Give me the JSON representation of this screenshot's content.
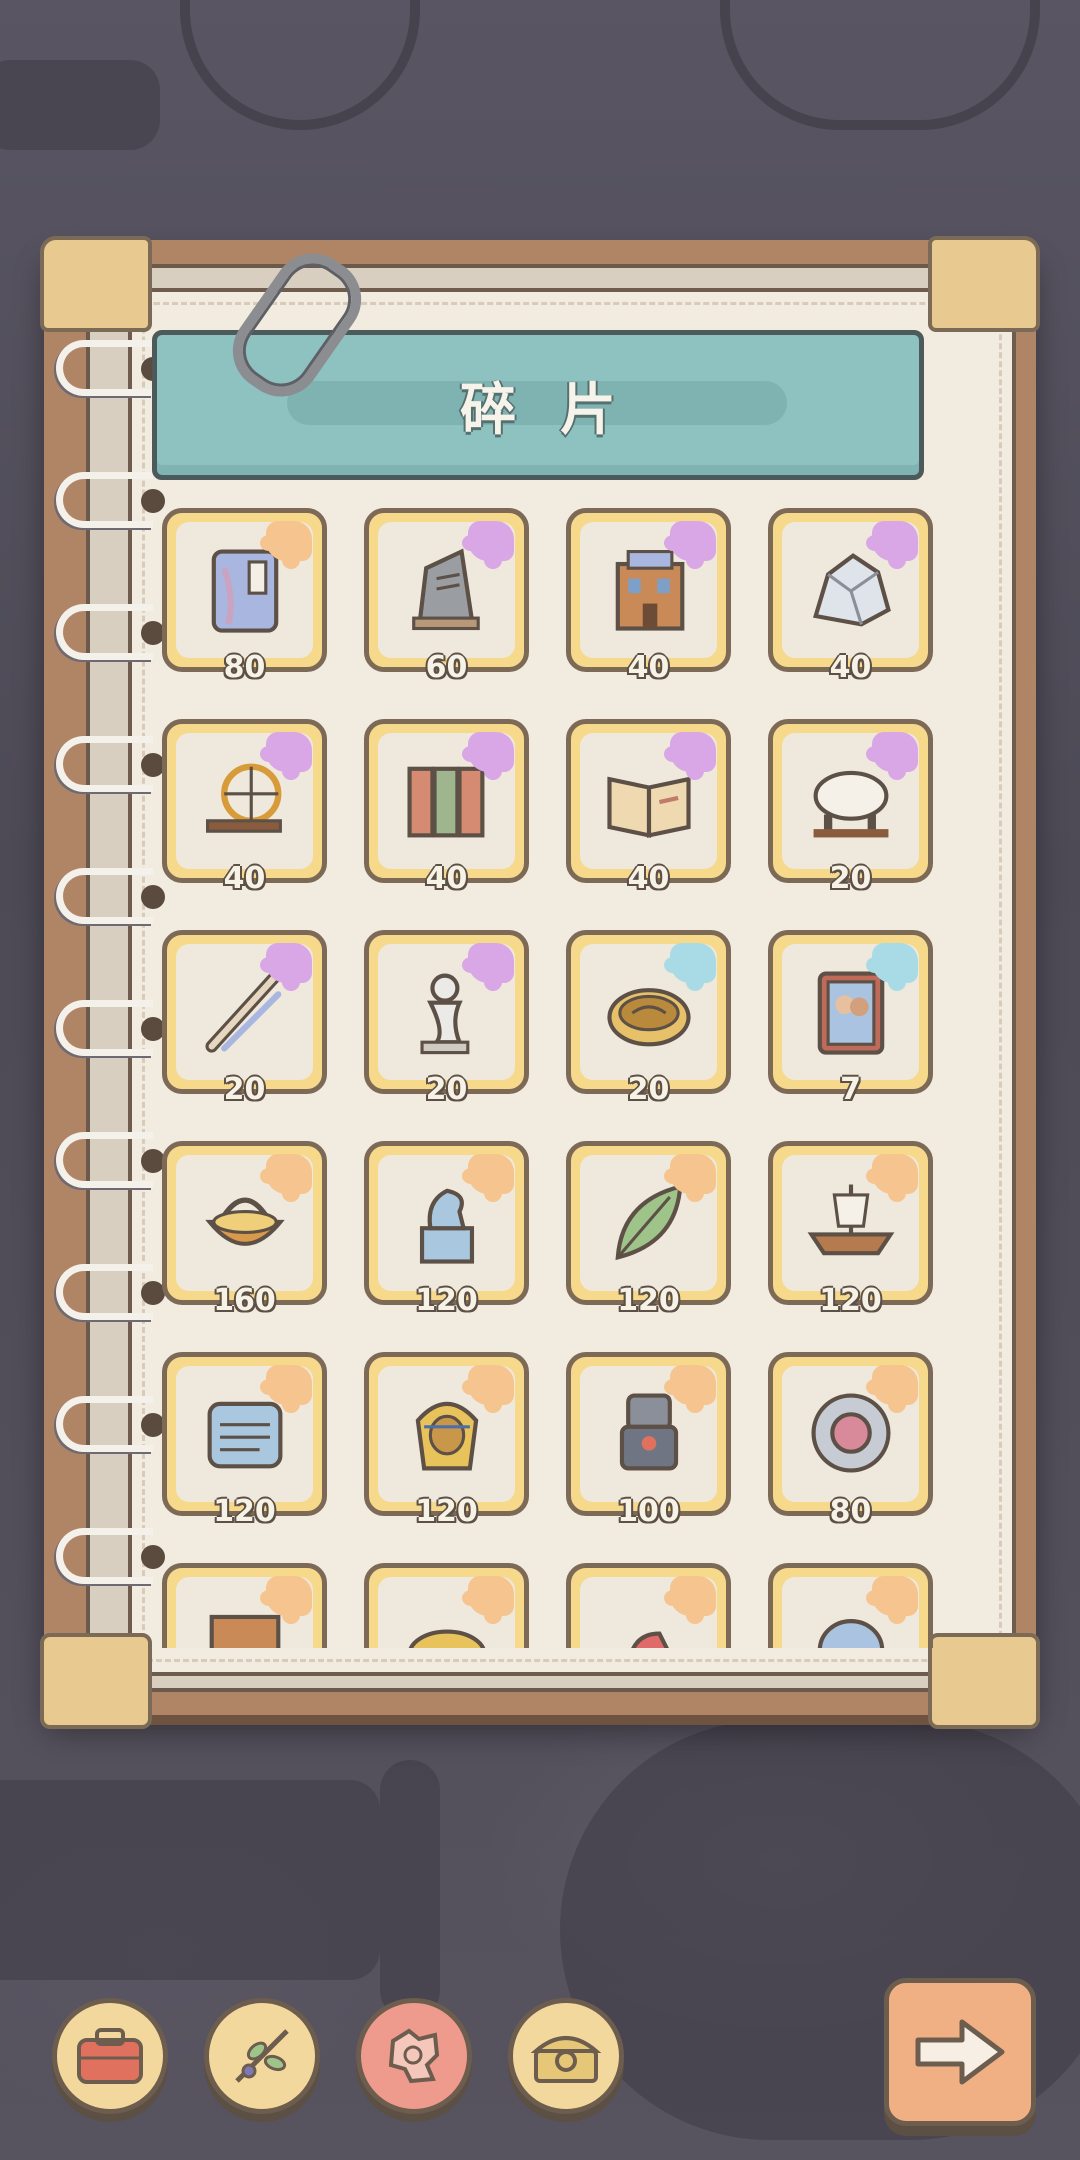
{
  "panel": {
    "title": "碎片"
  },
  "fragments": [
    {
      "name": "book-fragment",
      "count": "80",
      "badge_color": "#f6c48f"
    },
    {
      "name": "stone-tablet-fragment",
      "count": "60",
      "badge_color": "#d9a6e6"
    },
    {
      "name": "building-fragment",
      "count": "40",
      "badge_color": "#d9a6e6"
    },
    {
      "name": "crystal-rock-fragment",
      "count": "40",
      "badge_color": "#d9a6e6"
    },
    {
      "name": "spinning-wheel-fragment",
      "count": "40",
      "badge_color": "#d9a6e6"
    },
    {
      "name": "folding-screen-fragment",
      "count": "40",
      "badge_color": "#d9a6e6"
    },
    {
      "name": "open-book-fragment",
      "count": "40",
      "badge_color": "#d9a6e6"
    },
    {
      "name": "sheep-statue-fragment",
      "count": "20",
      "badge_color": "#d9a6e6"
    },
    {
      "name": "quill-fragment",
      "count": "20",
      "badge_color": "#d9a6e6"
    },
    {
      "name": "cherub-statue-fragment",
      "count": "20",
      "badge_color": "#d9a6e6"
    },
    {
      "name": "dish-fragment",
      "count": "20",
      "badge_color": "#a9dbe6"
    },
    {
      "name": "painting-fragment",
      "count": "7",
      "badge_color": "#a9dbe6"
    },
    {
      "name": "basket-fragment",
      "count": "160",
      "badge_color": "#f6c48f"
    },
    {
      "name": "dragon-statue-fragment",
      "count": "120",
      "badge_color": "#f6c48f"
    },
    {
      "name": "leaf-fragment",
      "count": "120",
      "badge_color": "#f6c48f"
    },
    {
      "name": "ship-fragment",
      "count": "120",
      "badge_color": "#f6c48f"
    },
    {
      "name": "inscribed-tablet-fragment",
      "count": "120",
      "badge_color": "#f6c48f"
    },
    {
      "name": "pharaoh-mask-fragment",
      "count": "120",
      "badge_color": "#f6c48f"
    },
    {
      "name": "robot-fragment",
      "count": "100",
      "badge_color": "#f6c48f"
    },
    {
      "name": "gem-brooch-fragment",
      "count": "80",
      "badge_color": "#f6c48f"
    },
    {
      "name": "portrait-fragment",
      "count": "",
      "badge_color": "#f6c48f"
    },
    {
      "name": "golden-relic-fragment",
      "count": "",
      "badge_color": "#f6c48f"
    },
    {
      "name": "red-shoe-fragment",
      "count": "",
      "badge_color": "#f6c48f"
    },
    {
      "name": "vase-fragment",
      "count": "",
      "badge_color": "#f6c48f"
    }
  ],
  "dock": [
    {
      "name": "toolbox-button",
      "icon": "toolbox-icon",
      "active": false
    },
    {
      "name": "branch-button",
      "icon": "branch-icon",
      "active": false
    },
    {
      "name": "fragments-button",
      "icon": "fragment-icon",
      "active": true
    },
    {
      "name": "treasure-chest-button",
      "icon": "chest-icon",
      "active": false
    }
  ],
  "colors": {
    "banner": "#8ec2c1",
    "card_gold": "#f6d98b",
    "active_dock": "#ee9a8c"
  }
}
